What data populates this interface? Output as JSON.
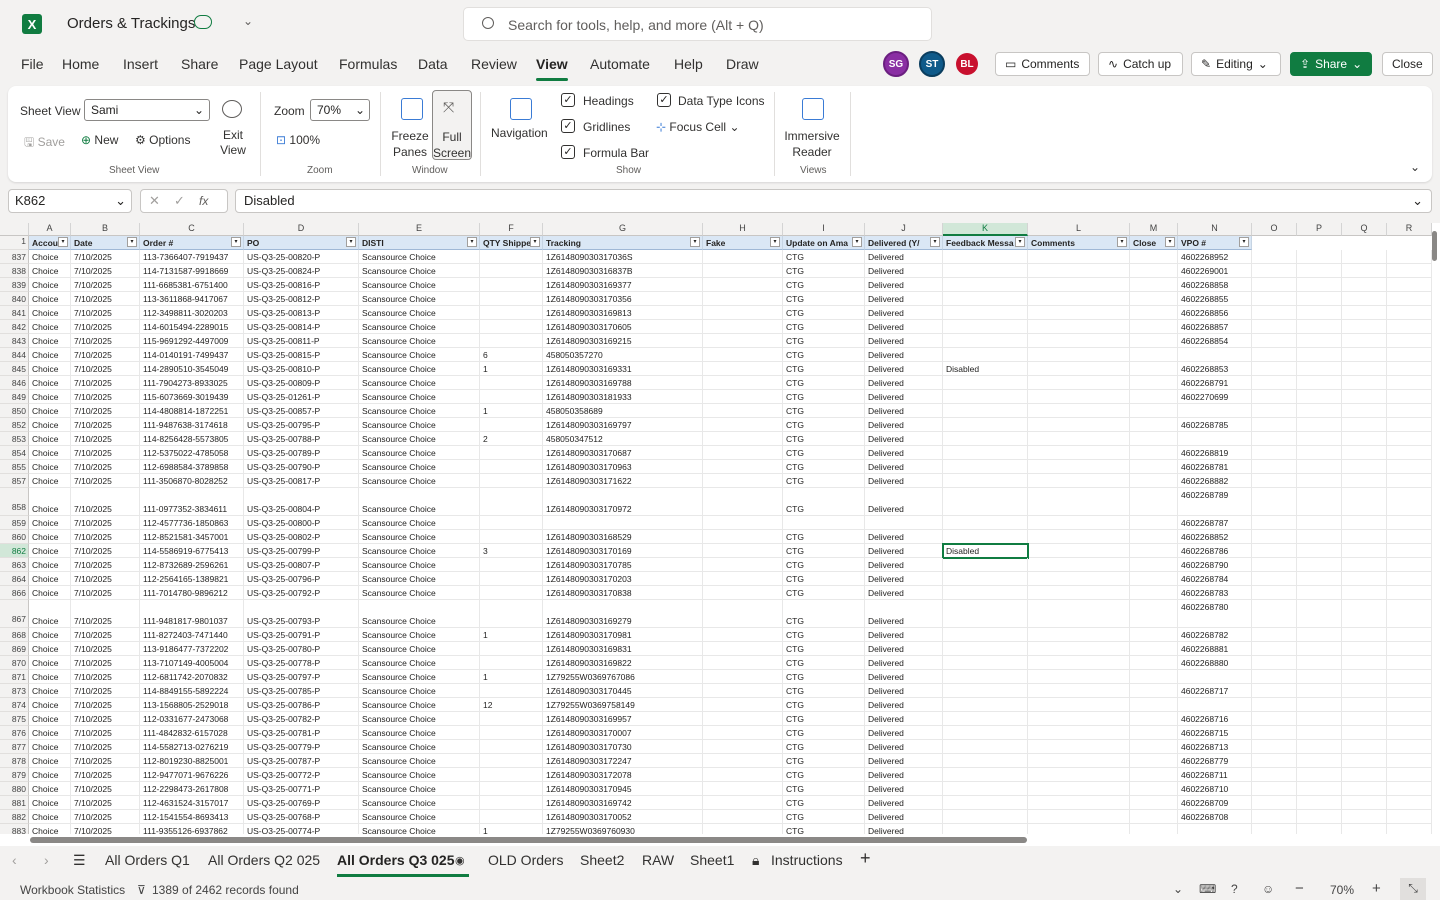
{
  "app": {
    "title": "Orders & Trackings"
  },
  "search": {
    "placeholder": "Search for tools, help, and more (Alt + Q)"
  },
  "menu": [
    "File",
    "Home",
    "Insert",
    "Share",
    "Page Layout",
    "Formulas",
    "Data",
    "Review",
    "View",
    "Automate",
    "Help",
    "Draw"
  ],
  "active_menu": "View",
  "avatars": [
    {
      "initials": "SG",
      "color": "#8a2ea3"
    },
    {
      "initials": "ST",
      "color": "#0f5a8a"
    },
    {
      "initials": "BL",
      "color": "#c8102e"
    }
  ],
  "top_buttons": {
    "comments": "Comments",
    "catchup": "Catch up",
    "editing": "Editing",
    "share": "Share",
    "close": "Close"
  },
  "ribbon": {
    "sheet_view_label": "Sheet View",
    "sheet_view_value": "Sami",
    "save": "Save",
    "new": "New",
    "options": "Options",
    "exit_view": "Exit View",
    "group_sheet_view": "Sheet View",
    "zoom_label": "Zoom",
    "zoom_value": "70%",
    "zoom_100": "100%",
    "group_zoom": "Zoom",
    "freeze_panes": "Freeze Panes",
    "full_screen": "Full Screen",
    "group_window": "Window",
    "navigation": "Navigation",
    "headings": "Headings",
    "gridlines": "Gridlines",
    "formula_bar": "Formula Bar",
    "data_type_icons": "Data Type Icons",
    "focus_cell": "Focus Cell",
    "group_show": "Show",
    "immersive_reader": "Immersive Reader",
    "group_views": "Views"
  },
  "formula_bar": {
    "name_box": "K862",
    "fx": "fx",
    "value": "Disabled"
  },
  "columns": [
    "A",
    "B",
    "C",
    "D",
    "E",
    "F",
    "G",
    "H",
    "I",
    "J",
    "K",
    "L",
    "M",
    "N",
    "O",
    "P",
    "Q",
    "R"
  ],
  "headers": [
    "Accou",
    "Date",
    "Order #",
    "PO",
    "DISTI",
    "QTY Shippe",
    "Tracking",
    "Fake",
    "Update on Ama",
    "Delivered (Y/",
    "Feedback Messa",
    "Comments",
    "Close",
    "VPO #"
  ],
  "rows": [
    [
      "837",
      "Choice",
      "7/10/2025",
      "113-7366407-7919437",
      "US-Q3-25-00820-P",
      "Scansource Choice",
      "",
      "1Z614809030317036S",
      "",
      "CTG",
      "Delivered",
      "",
      "",
      "",
      "4602268952"
    ],
    [
      "838",
      "Choice",
      "7/10/2025",
      "114-7131587-9918669",
      "US-Q3-25-00824-P",
      "Scansource Choice",
      "",
      "1Z614809030316837B",
      "",
      "CTG",
      "Delivered",
      "",
      "",
      "",
      "4602269001"
    ],
    [
      "839",
      "Choice",
      "7/10/2025",
      "111-6685381-6751400",
      "US-Q3-25-00816-P",
      "Scansource Choice",
      "",
      "1Z6148090303169377",
      "",
      "CTG",
      "Delivered",
      "",
      "",
      "",
      "4602268858"
    ],
    [
      "840",
      "Choice",
      "7/10/2025",
      "113-3611868-9417067",
      "US-Q3-25-00812-P",
      "Scansource Choice",
      "",
      "1Z6148090303170356",
      "",
      "CTG",
      "Delivered",
      "",
      "",
      "",
      "4602268855"
    ],
    [
      "841",
      "Choice",
      "7/10/2025",
      "112-3498811-3020203",
      "US-Q3-25-00813-P",
      "Scansource Choice",
      "",
      "1Z6148090303169813",
      "",
      "CTG",
      "Delivered",
      "",
      "",
      "",
      "4602268856"
    ],
    [
      "842",
      "Choice",
      "7/10/2025",
      "114-6015494-2289015",
      "US-Q3-25-00814-P",
      "Scansource Choice",
      "",
      "1Z6148090303170605",
      "",
      "CTG",
      "Delivered",
      "",
      "",
      "",
      "4602268857"
    ],
    [
      "843",
      "Choice",
      "7/10/2025",
      "115-9691292-4497009",
      "US-Q3-25-00811-P",
      "Scansource Choice",
      "",
      "1Z6148090303169215",
      "",
      "CTG",
      "Delivered",
      "",
      "",
      "",
      "4602268854"
    ],
    [
      "844",
      "Choice",
      "7/10/2025",
      "114-0140191-7499437",
      "US-Q3-25-00815-P",
      "Scansource Choice",
      "6",
      "458050357270",
      "",
      "CTG",
      "Delivered",
      "",
      "",
      "",
      ""
    ],
    [
      "845",
      "Choice",
      "7/10/2025",
      "114-2890510-3545049",
      "US-Q3-25-00810-P",
      "Scansource Choice",
      "1",
      "1Z6148090303169331",
      "",
      "CTG",
      "Delivered",
      "Disabled",
      "",
      "",
      "4602268853"
    ],
    [
      "846",
      "Choice",
      "7/10/2025",
      "111-7904273-8933025",
      "US-Q3-25-00809-P",
      "Scansource Choice",
      "",
      "1Z6148090303169788",
      "",
      "CTG",
      "Delivered",
      "",
      "",
      "",
      "4602268791"
    ],
    [
      "849",
      "Choice",
      "7/10/2025",
      "115-6073669-3019439",
      "US-Q3-25-01261-P",
      "Scansource Choice",
      "",
      "1Z6148090303181933",
      "",
      "CTG",
      "Delivered",
      "",
      "",
      "",
      "4602270699"
    ],
    [
      "850",
      "Choice",
      "7/10/2025",
      "114-4808814-1872251",
      "US-Q3-25-00857-P",
      "Scansource Choice",
      "1",
      "458050358689",
      "",
      "CTG",
      "Delivered",
      "",
      "",
      "",
      ""
    ],
    [
      "852",
      "Choice",
      "7/10/2025",
      "111-9487638-3174618",
      "US-Q3-25-00795-P",
      "Scansource Choice",
      "",
      "1Z6148090303169797",
      "",
      "CTG",
      "Delivered",
      "",
      "",
      "",
      "4602268785"
    ],
    [
      "853",
      "Choice",
      "7/10/2025",
      "114-8256428-5573805",
      "US-Q3-25-00788-P",
      "Scansource Choice",
      "2",
      "458050347512",
      "",
      "CTG",
      "Delivered",
      "",
      "",
      "",
      ""
    ],
    [
      "854",
      "Choice",
      "7/10/2025",
      "112-5375022-4785058",
      "US-Q3-25-00789-P",
      "Scansource Choice",
      "",
      "1Z6148090303170687",
      "",
      "CTG",
      "Delivered",
      "",
      "",
      "",
      "4602268819"
    ],
    [
      "855",
      "Choice",
      "7/10/2025",
      "112-6988584-3789858",
      "US-Q3-25-00790-P",
      "Scansource Choice",
      "",
      "1Z6148090303170963",
      "",
      "CTG",
      "Delivered",
      "",
      "",
      "",
      "4602268781"
    ],
    [
      "857",
      "Choice",
      "7/10/2025",
      "111-3506870-8028252",
      "US-Q3-25-00817-P",
      "Scansource Choice",
      "",
      "1Z6148090303171622",
      "",
      "CTG",
      "Delivered",
      "",
      "",
      "",
      "4602268882"
    ],
    [
      "858",
      "Choice",
      "7/10/2025",
      "111-0977352-3834611",
      "US-Q3-25-00804-P",
      "Scansource Choice",
      "",
      "1Z6148090303170972",
      "",
      "CTG",
      "Delivered",
      "",
      "",
      "",
      "4602268789"
    ],
    [
      "859",
      "Choice",
      "7/10/2025",
      "112-4577736-1850863",
      "US-Q3-25-00800-P",
      "Scansource Choice",
      "",
      "",
      "",
      "",
      "",
      "",
      "",
      "",
      "4602268787"
    ],
    [
      "860",
      "Choice",
      "7/10/2025",
      "112-8521581-3457001",
      "US-Q3-25-00802-P",
      "Scansource Choice",
      "",
      "1Z6148090303168529",
      "",
      "CTG",
      "Delivered",
      "",
      "",
      "",
      "4602268852"
    ],
    [
      "862",
      "Choice",
      "7/10/2025",
      "114-5586919-6775413",
      "US-Q3-25-00799-P",
      "Scansource Choice",
      "3",
      "1Z6148090303170169",
      "",
      "CTG",
      "Delivered",
      "Disabled",
      "",
      "",
      "4602268786"
    ],
    [
      "863",
      "Choice",
      "7/10/2025",
      "112-8732689-2596261",
      "US-Q3-25-00807-P",
      "Scansource Choice",
      "",
      "1Z6148090303170785",
      "",
      "CTG",
      "Delivered",
      "",
      "",
      "",
      "4602268790"
    ],
    [
      "864",
      "Choice",
      "7/10/2025",
      "112-2564165-1389821",
      "US-Q3-25-00796-P",
      "Scansource Choice",
      "",
      "1Z6148090303170203",
      "",
      "CTG",
      "Delivered",
      "",
      "",
      "",
      "4602268784"
    ],
    [
      "866",
      "Choice",
      "7/10/2025",
      "111-7014780-9896212",
      "US-Q3-25-00792-P",
      "Scansource Choice",
      "",
      "1Z6148090303170838",
      "",
      "CTG",
      "Delivered",
      "",
      "",
      "",
      "4602268783"
    ],
    [
      "867",
      "Choice",
      "7/10/2025",
      "111-9481817-9801037",
      "US-Q3-25-00793-P",
      "Scansource Choice",
      "",
      "1Z6148090303169279",
      "",
      "CTG",
      "Delivered",
      "",
      "",
      "",
      "4602268780"
    ],
    [
      "868",
      "Choice",
      "7/10/2025",
      "111-8272403-7471440",
      "US-Q3-25-00791-P",
      "Scansource Choice",
      "1",
      "1Z6148090303170981",
      "",
      "CTG",
      "Delivered",
      "",
      "",
      "",
      "4602268782"
    ],
    [
      "869",
      "Choice",
      "7/10/2025",
      "113-9186477-7372202",
      "US-Q3-25-00780-P",
      "Scansource Choice",
      "",
      "1Z6148090303169831",
      "",
      "CTG",
      "Delivered",
      "",
      "",
      "",
      "4602268881"
    ],
    [
      "870",
      "Choice",
      "7/10/2025",
      "113-7107149-4005004",
      "US-Q3-25-00778-P",
      "Scansource Choice",
      "",
      "1Z6148090303169822",
      "",
      "CTG",
      "Delivered",
      "",
      "",
      "",
      "4602268880"
    ],
    [
      "871",
      "Choice",
      "7/10/2025",
      "112-6811742-2070832",
      "US-Q3-25-00797-P",
      "Scansource Choice",
      "1",
      "1Z79255W0369767086",
      "",
      "CTG",
      "Delivered",
      "",
      "",
      "",
      ""
    ],
    [
      "873",
      "Choice",
      "7/10/2025",
      "114-8849155-5892224",
      "US-Q3-25-00785-P",
      "Scansource Choice",
      "",
      "1Z6148090303170445",
      "",
      "CTG",
      "Delivered",
      "",
      "",
      "",
      "4602268717"
    ],
    [
      "874",
      "Choice",
      "7/10/2025",
      "113-1568805-2529018",
      "US-Q3-25-00786-P",
      "Scansource Choice",
      "12",
      "1Z79255W0369758149",
      "",
      "CTG",
      "Delivered",
      "",
      "",
      "",
      ""
    ],
    [
      "875",
      "Choice",
      "7/10/2025",
      "112-0331677-2473068",
      "US-Q3-25-00782-P",
      "Scansource Choice",
      "",
      "1Z6148090303169957",
      "",
      "CTG",
      "Delivered",
      "",
      "",
      "",
      "4602268716"
    ],
    [
      "876",
      "Choice",
      "7/10/2025",
      "111-4842832-6157028",
      "US-Q3-25-00781-P",
      "Scansource Choice",
      "",
      "1Z6148090303170007",
      "",
      "CTG",
      "Delivered",
      "",
      "",
      "",
      "4602268715"
    ],
    [
      "877",
      "Choice",
      "7/10/2025",
      "114-5582713-0276219",
      "US-Q3-25-00779-P",
      "Scansource Choice",
      "",
      "1Z6148090303170730",
      "",
      "CTG",
      "Delivered",
      "",
      "",
      "",
      "4602268713"
    ],
    [
      "878",
      "Choice",
      "7/10/2025",
      "112-8019230-8825001",
      "US-Q3-25-00787-P",
      "Scansource Choice",
      "",
      "1Z6148090303172247",
      "",
      "CTG",
      "Delivered",
      "",
      "",
      "",
      "4602268779"
    ],
    [
      "879",
      "Choice",
      "7/10/2025",
      "112-9477071-9676226",
      "US-Q3-25-00772-P",
      "Scansource Choice",
      "",
      "1Z6148090303172078",
      "",
      "CTG",
      "Delivered",
      "",
      "",
      "",
      "4602268711"
    ],
    [
      "880",
      "Choice",
      "7/10/2025",
      "112-2298473-2617808",
      "US-Q3-25-00771-P",
      "Scansource Choice",
      "",
      "1Z6148090303170945",
      "",
      "CTG",
      "Delivered",
      "",
      "",
      "",
      "4602268710"
    ],
    [
      "881",
      "Choice",
      "7/10/2025",
      "112-4631524-3157017",
      "US-Q3-25-00769-P",
      "Scansource Choice",
      "",
      "1Z6148090303169742",
      "",
      "CTG",
      "Delivered",
      "",
      "",
      "",
      "4602268709"
    ],
    [
      "882",
      "Choice",
      "7/10/2025",
      "112-1541554-8693413",
      "US-Q3-25-00768-P",
      "Scansource Choice",
      "",
      "1Z6148090303170052",
      "",
      "CTG",
      "Delivered",
      "",
      "",
      "",
      "4602268708"
    ],
    [
      "883",
      "Choice",
      "7/10/2025",
      "111-9355126-6937862",
      "US-Q3-25-00774-P",
      "Scansource Choice",
      "1",
      "1Z79255W0369760930",
      "",
      "CTG",
      "Delivered",
      "",
      "",
      "",
      ""
    ]
  ],
  "tall_rows": [
    "858",
    "867"
  ],
  "selected_row": "862",
  "sheet_tabs": [
    "All Orders Q1",
    "All Orders Q2 025",
    "All Orders Q3 025",
    "OLD Orders",
    "Sheet2",
    "RAW",
    "Sheet1",
    "Instructions"
  ],
  "active_tab": "All Orders Q3 025",
  "status": {
    "workbook_stats": "Workbook Statistics",
    "records": "1389 of 2462 records found",
    "zoom": "70%"
  }
}
